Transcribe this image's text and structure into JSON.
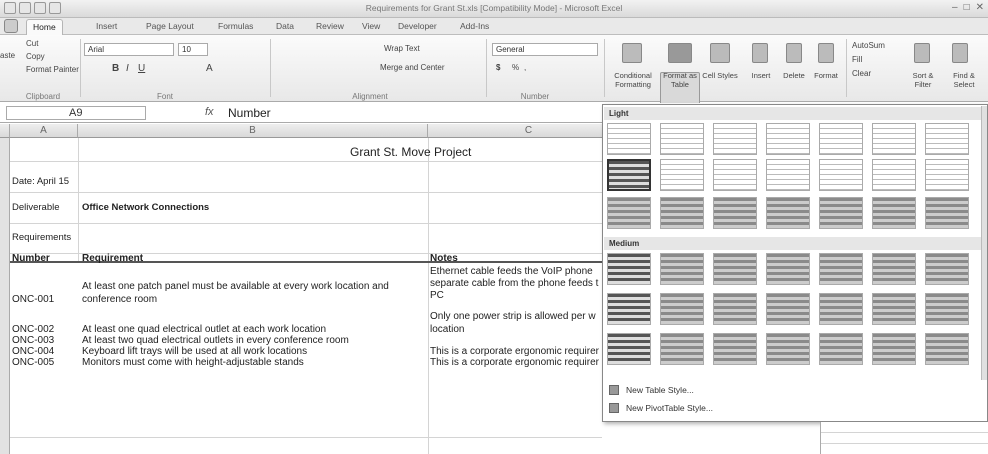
{
  "window": {
    "title": "Requirements for Grant St.xls  [Compatibility Mode] - Microsoft Excel"
  },
  "tabs": [
    "Home",
    "Insert",
    "Page Layout",
    "Formulas",
    "Data",
    "Review",
    "View",
    "Developer",
    "Add-Ins"
  ],
  "ribbon": {
    "clipboard": {
      "cut": "Cut",
      "copy": "Copy",
      "paste_prefix": "aste",
      "format_painter": "Format Painter",
      "label": "Clipboard"
    },
    "font": {
      "name": "Arial",
      "size": "10",
      "label": "Font"
    },
    "alignment": {
      "wrap_text": "Wrap Text",
      "merge_center": "Merge and Center",
      "label": "Alignment"
    },
    "number": {
      "format": "General",
      "currency": "$",
      "percent": "%",
      "comma": ",",
      "label": "Number"
    },
    "styles": {
      "conditional": "Conditional Formatting",
      "format_table": "Format as Table",
      "cell_styles": "Cell Styles"
    },
    "cells": {
      "insert": "Insert",
      "delete": "Delete",
      "format": "Format"
    },
    "editing": {
      "autosum": "AutoSum",
      "fill": "Fill",
      "clear": "Clear",
      "sort_filter": "Sort & Filter",
      "find_select": "Find & Select"
    }
  },
  "formula_bar": {
    "name_box": "A9",
    "fx": "fx",
    "value": "Number"
  },
  "columns": [
    "A",
    "B",
    "C"
  ],
  "sheet": {
    "title": "Grant St. Move Project",
    "date": "Date: April 15",
    "deliverable_label": "Deliverable",
    "deliverable_value": "Office Network Connections",
    "requirements_label": "Requirements",
    "headers": {
      "number": "Number",
      "requirement": "Requirement",
      "notes": "Notes"
    },
    "rows": [
      {
        "number": "ONC-001",
        "requirement": [
          "At least one patch panel must be available at every work location and",
          "conference room"
        ],
        "notes": [
          "Ethernet cable feeds the VoIP phone",
          "separate cable from the phone feeds t",
          "PC"
        ]
      },
      {
        "number": "ONC-002",
        "requirement": [
          "At least one quad electrical outlet at each work location"
        ],
        "notes": [
          "Only one power strip is allowed per w",
          "location"
        ]
      },
      {
        "number": "ONC-003",
        "requirement": [
          "At least two quad electrical outlets in every conference room"
        ],
        "notes": [
          ""
        ]
      },
      {
        "number": "ONC-004",
        "requirement": [
          "Keyboard lift trays will be used at all work locations"
        ],
        "notes": [
          "This is a corporate ergonomic requirer"
        ]
      },
      {
        "number": "ONC-005",
        "requirement": [
          "Monitors must come with height-adjustable stands"
        ],
        "notes": [
          "This is a corporate ergonomic requirer"
        ]
      }
    ]
  },
  "gallery": {
    "light_label": "Light",
    "medium_label": "Medium",
    "new_table_style": "New Table Style...",
    "new_pivot_style": "New PivotTable Style..."
  }
}
